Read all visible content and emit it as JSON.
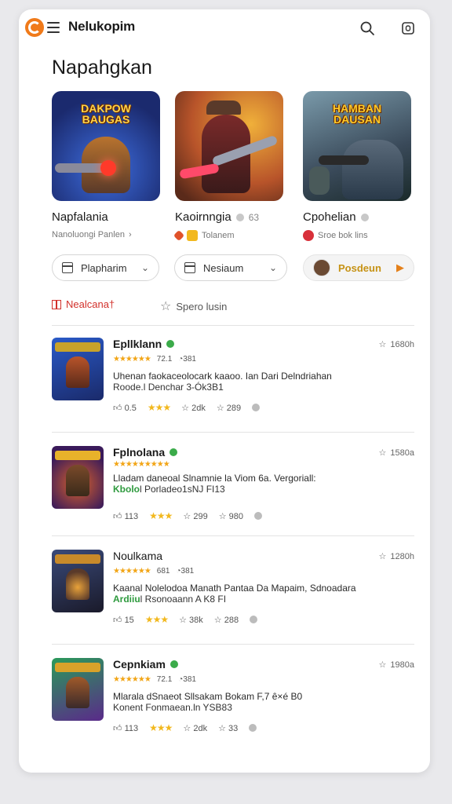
{
  "app": {
    "title": "Nelukopim"
  },
  "section": {
    "title": "Napahgkan"
  },
  "featured": [
    {
      "art_text": "DAKPOW BAUGAS",
      "name": "Napfalania",
      "rating": "",
      "meta": "Nanoluongi Panlen",
      "meta_suffix": "›",
      "colors": [
        "#2a4fb8",
        "#8a3a3a"
      ]
    },
    {
      "art_text": "",
      "name": "Kaoirnngia",
      "rating": "63",
      "meta": "Tolanem",
      "meta_suffix": "",
      "colors": [
        "#d4782a",
        "#7a1f2a"
      ]
    },
    {
      "art_text": "HAMBAN DAUSAN",
      "name": "Cpohelian",
      "rating": "",
      "meta": "Sroe bok lins",
      "meta_suffix": "",
      "colors": [
        "#4a6a7a",
        "#2a3a4a"
      ]
    }
  ],
  "chips": [
    {
      "label": "Plapharim"
    },
    {
      "label": "Nesiaum"
    },
    {
      "label": "Posdeun"
    }
  ],
  "tabs": [
    {
      "label": "Nealcana†"
    },
    {
      "label": "Spero lusin"
    }
  ],
  "list": [
    {
      "name": "Epllklann",
      "stars": "★★★★★★",
      "score": "72.1",
      "reviews": "◔381",
      "desc1": "Uhenan faokaceolocark kaaoo. Ian Dari Delndriahan",
      "desc2_green": "",
      "desc2": "Roode.l Denchar 3-Ók3B1",
      "s1": "0.5",
      "s2": "2dk",
      "s3": "289",
      "date": "1680h",
      "thumb": [
        "#1b3a9a",
        "#a33a1a"
      ]
    },
    {
      "name": "Fplnolana",
      "stars": "★★★★★★★★★",
      "score": "",
      "reviews": "",
      "desc1": "Lladam daneoal Slnamnie la Viom 6a. Vergoriall:",
      "desc2_green": "Kbolo",
      "desc2": "l Porladeo1sNJ FI13",
      "s1": "113",
      "s2": "299",
      "s3": "980",
      "date": "1580a",
      "thumb": [
        "#3a1a5a",
        "#d9622a"
      ]
    },
    {
      "name": "Noulkama",
      "stars": "★★★★★★",
      "score": "681",
      "reviews": "◔381",
      "desc1": "Kaanal Nolelodoa Manath Pantaa Da Mapaim, Sdnoadara",
      "desc2_green": "Ardiiu",
      "desc2": "l Rsonoaann A K8 FI",
      "s1": "15",
      "s2": "38k",
      "s3": "288",
      "date": "1280h",
      "thumb": [
        "#2a2a4a",
        "#c8782a"
      ]
    },
    {
      "name": "Cepnkiam",
      "stars": "★★★★★★",
      "score": "72.1",
      "reviews": "◔381",
      "desc1": "Mlarala dSnaeot Sllsakam Bokam F,7 ê×é B0",
      "desc2_green": "",
      "desc2": "Konent Fonmaean.ln YSB83",
      "s1": "113",
      "s2": "2dk",
      "s3": "33",
      "date": "1980a",
      "thumb": [
        "#1f7a4a",
        "#7a3aa0"
      ]
    }
  ]
}
